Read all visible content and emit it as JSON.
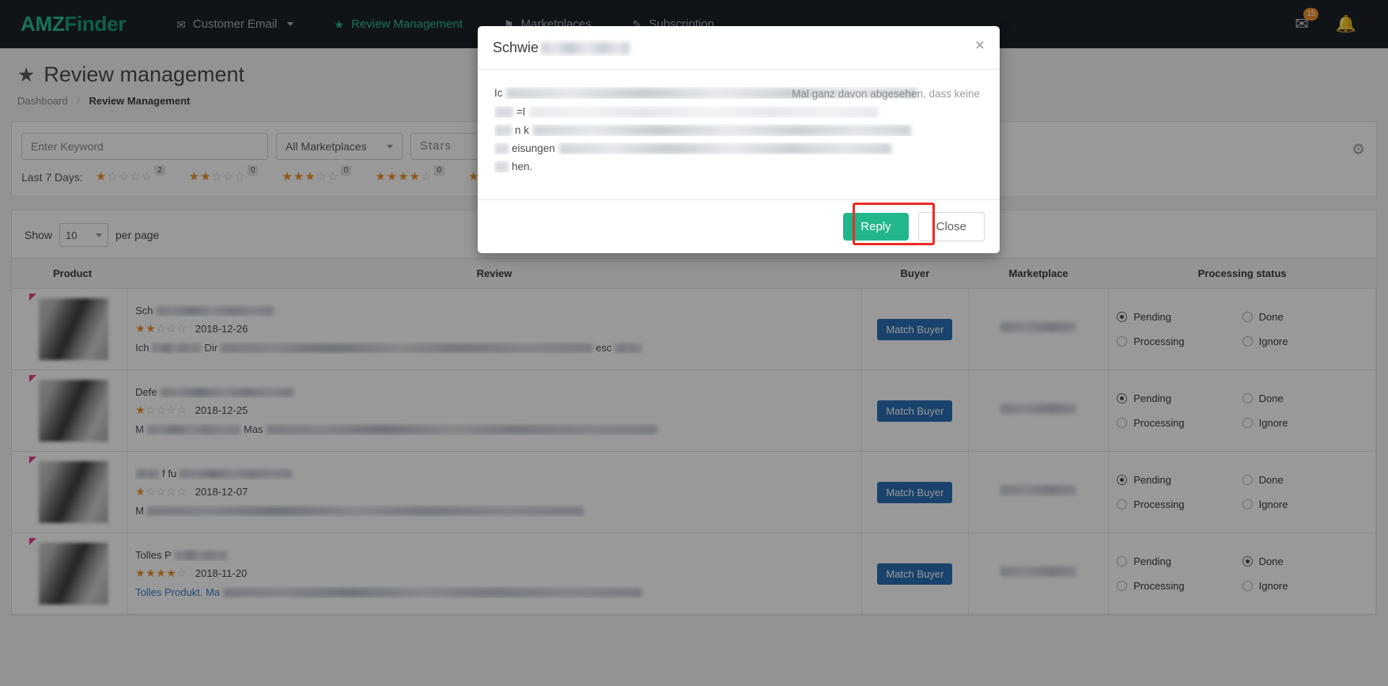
{
  "navbar": {
    "logo_amz": "AMZ",
    "logo_finder": "Finder",
    "items": [
      {
        "label": "Customer Email",
        "icon": "envelope-icon",
        "glyph": "✉",
        "has_caret": true,
        "active": false
      },
      {
        "label": "Review Management",
        "icon": "star-icon",
        "glyph": "★",
        "has_caret": false,
        "active": true
      },
      {
        "label": "Marketplaces",
        "icon": "shop-icon",
        "glyph": "⚑",
        "has_caret": false,
        "active": false
      },
      {
        "label": "Subscription",
        "icon": "key-icon",
        "glyph": "✎",
        "has_caret": false,
        "active": false
      }
    ],
    "mail_icon": "envelope-icon",
    "mail_glyph": "✉",
    "mail_badge": "15",
    "bell_icon": "bell-icon",
    "bell_glyph": "🔔",
    "badge_color": "#f0932b",
    "brand_color": "#2bbd92",
    "bg_color": "#1b222b"
  },
  "page": {
    "title": "Review management",
    "title_icon": "star-icon",
    "title_glyph": "★",
    "breadcrumb": {
      "root": "Dashboard",
      "separator": "/",
      "current": "Review Management"
    }
  },
  "filters": {
    "keyword_placeholder": "Enter Keyword",
    "keyword_value": "",
    "marketplace_value": "All Marketplaces",
    "stars_value": "Stars",
    "more_value": "",
    "gear_icon": "gear-icon",
    "gear_glyph": "⚙",
    "last_days_label": "Last 7 Days:",
    "star_filters": [
      {
        "filled": 1,
        "total": 5,
        "count": "2"
      },
      {
        "filled": 2,
        "total": 5,
        "count": "0"
      },
      {
        "filled": 3,
        "total": 5,
        "count": "0"
      },
      {
        "filled": 4,
        "total": 5,
        "count": "0"
      },
      {
        "filled": 5,
        "total": 5,
        "count": ""
      }
    ]
  },
  "table": {
    "show_label": "Show",
    "per_page_value": "10",
    "per_page_label": "per page",
    "columns": [
      "Product",
      "Review",
      "Buyer",
      "Marketplace",
      "Processing status"
    ],
    "buyer_button_label": "Match Buyer",
    "status_options": [
      "Pending",
      "Done",
      "Processing",
      "Ignore"
    ],
    "rows": [
      {
        "title_visible": "Sch",
        "title_blur_width": 148,
        "stars_filled": 2,
        "date": "2018-12-26",
        "body_visible": "Ich",
        "body_mid": "Dir",
        "body_tail": "esc",
        "status_selected": "Pending"
      },
      {
        "title_visible": "Defe",
        "title_blur_width": 168,
        "stars_filled": 1,
        "date": "2018-12-25",
        "body_visible": "M",
        "body_mid": "Mas",
        "body_tail": "",
        "status_selected": "Pending"
      },
      {
        "title_visible": "f fu",
        "title_blur_width": 178,
        "stars_filled": 1,
        "date": "2018-12-07",
        "body_visible": "M",
        "body_mid": "",
        "body_tail": "",
        "status_selected": "Pending"
      },
      {
        "title_visible": "Tolles P",
        "title_blur_width": 66,
        "stars_filled": 4,
        "date": "2018-11-20",
        "body_visible": "Tolles Produkt. Ma",
        "body_mid": "",
        "body_tail": "",
        "status_selected": "Done"
      }
    ]
  },
  "modal": {
    "title_visible": "Schwie",
    "title_blur_width": 112,
    "close_icon": "close-icon",
    "close_glyph": "×",
    "body_lines": [
      {
        "lead": "Ic",
        "blur": 520,
        "tail": "Mal ganz davon abgesehen, dass keine"
      },
      {
        "lead": "=l",
        "blur": 0,
        "tail": ""
      },
      {
        "lead": "n k",
        "blur": 478,
        "tail": ""
      },
      {
        "lead": "eisungen",
        "blur": 420,
        "tail": ""
      },
      {
        "lead": "hen.",
        "blur": 0,
        "tail": ""
      }
    ],
    "reply_label": "Reply",
    "close_label": "Close",
    "reply_color": "#21b68c",
    "highlight_color": "#ee2b24"
  }
}
